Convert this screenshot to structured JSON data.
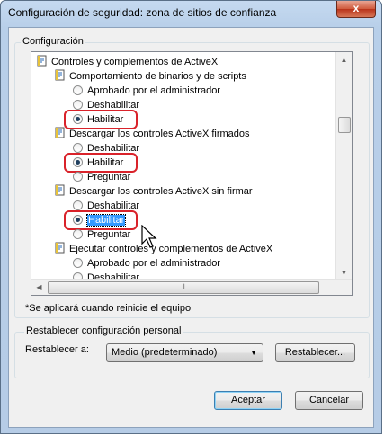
{
  "window": {
    "title": "Configuración de seguridad: zona de sitios de confianza",
    "close_label": "x"
  },
  "settings_group": {
    "legend": "Configuración"
  },
  "tree": {
    "items": [
      {
        "kind": "folder",
        "label": "Controles y complementos de ActiveX",
        "level": 0
      },
      {
        "kind": "folder",
        "label": "Comportamiento de binarios y de scripts",
        "level": 1
      },
      {
        "kind": "radio",
        "label": "Aprobado por el administrador",
        "checked": false
      },
      {
        "kind": "radio",
        "label": "Deshabilitar",
        "checked": false
      },
      {
        "kind": "radio",
        "label": "Habilitar",
        "checked": true,
        "highlighted": true
      },
      {
        "kind": "folder",
        "label": "Descargar los controles ActiveX firmados",
        "level": 1
      },
      {
        "kind": "radio",
        "label": "Deshabilitar",
        "checked": false
      },
      {
        "kind": "radio",
        "label": "Habilitar",
        "checked": true,
        "highlighted": true
      },
      {
        "kind": "radio",
        "label": "Preguntar",
        "checked": false
      },
      {
        "kind": "folder",
        "label": "Descargar los controles ActiveX sin firmar",
        "level": 1
      },
      {
        "kind": "radio",
        "label": "Deshabilitar",
        "checked": false
      },
      {
        "kind": "radio",
        "label": "Habilitar",
        "checked": true,
        "highlighted": true,
        "selected": true
      },
      {
        "kind": "radio",
        "label": "Preguntar",
        "checked": false
      },
      {
        "kind": "folder",
        "label": "Ejecutar controles y complementos de ActiveX",
        "level": 1
      },
      {
        "kind": "radio",
        "label": "Aprobado por el administrador",
        "checked": false
      },
      {
        "kind": "radio",
        "label": "Deshabilitar",
        "checked": false
      }
    ]
  },
  "note": "*Se aplicará cuando reinicie el equipo",
  "reset_group": {
    "legend": "Restablecer configuración personal",
    "reset_to_label": "Restablecer a:",
    "reset_to_value": "Medio (predeterminado)",
    "reset_button": "Restablecer..."
  },
  "footer": {
    "ok": "Aceptar",
    "cancel": "Cancelar"
  },
  "colors": {
    "highlight_ring": "#d9222a",
    "selection": "#3399ff"
  }
}
